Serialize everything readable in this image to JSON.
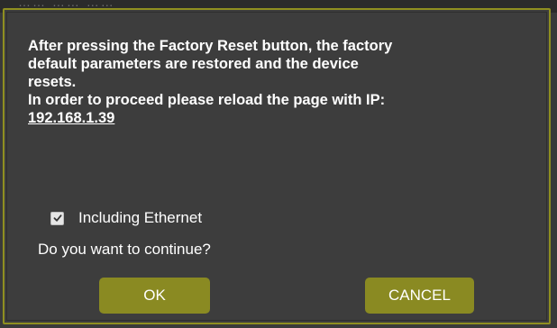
{
  "background": {
    "partial_text": "…… …… ……"
  },
  "dialog": {
    "message_lines": [
      "After pressing the Factory Reset button, the factory",
      "default parameters are restored and the device",
      "resets.",
      "In order to proceed please reload the page with IP:"
    ],
    "ip_address": "192.168.1.39",
    "ethernet_checkbox": {
      "label": "Including Ethernet",
      "checked": true
    },
    "question": "Do you want to continue?",
    "ok_label": "OK",
    "cancel_label": "CANCEL"
  },
  "colors": {
    "dialog_bg": "#3d3d3d",
    "border": "#8f8f20",
    "button_bg": "#8a8a22",
    "text": "#ffffff"
  }
}
